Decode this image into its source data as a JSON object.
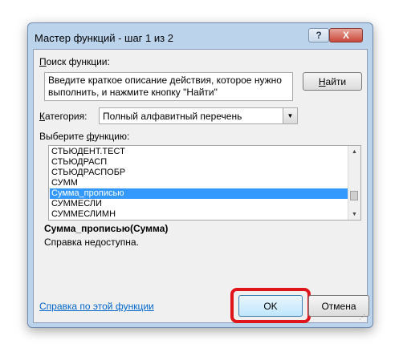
{
  "dialog": {
    "title": "Мастер функций - шаг 1 из 2",
    "help_button": "?",
    "close_button": "X"
  },
  "search": {
    "label_prefix": "П",
    "label_rest": "оиск функции:",
    "text": "Введите краткое описание действия, которое нужно выполнить, и нажмите кнопку \"Найти\"",
    "find_prefix": "Н",
    "find_rest": "айти"
  },
  "category": {
    "label_prefix": "К",
    "label_rest": "атегория:",
    "selected": "Полный алфавитный перечень"
  },
  "function_list": {
    "label_text": "Выберите ",
    "label_ul": "ф",
    "label_rest": "ункцию:",
    "items": [
      "СТЬЮДЕНТ.ТЕСТ",
      "СТЬЮДРАСП",
      "СТЬЮДРАСПОБР",
      "СУММ",
      "Сумма_прописью",
      "СУММЕСЛИ",
      "СУММЕСЛИМН"
    ],
    "selected_index": 4
  },
  "details": {
    "signature": "Сумма_прописью(Сумма)",
    "description": "Справка недоступна."
  },
  "footer": {
    "help_link": "Справка по этой функции",
    "ok": "OK",
    "cancel": "Отмена"
  },
  "colors": {
    "selection": "#3399ff",
    "highlight": "#e0141b",
    "link": "#0066cc"
  }
}
